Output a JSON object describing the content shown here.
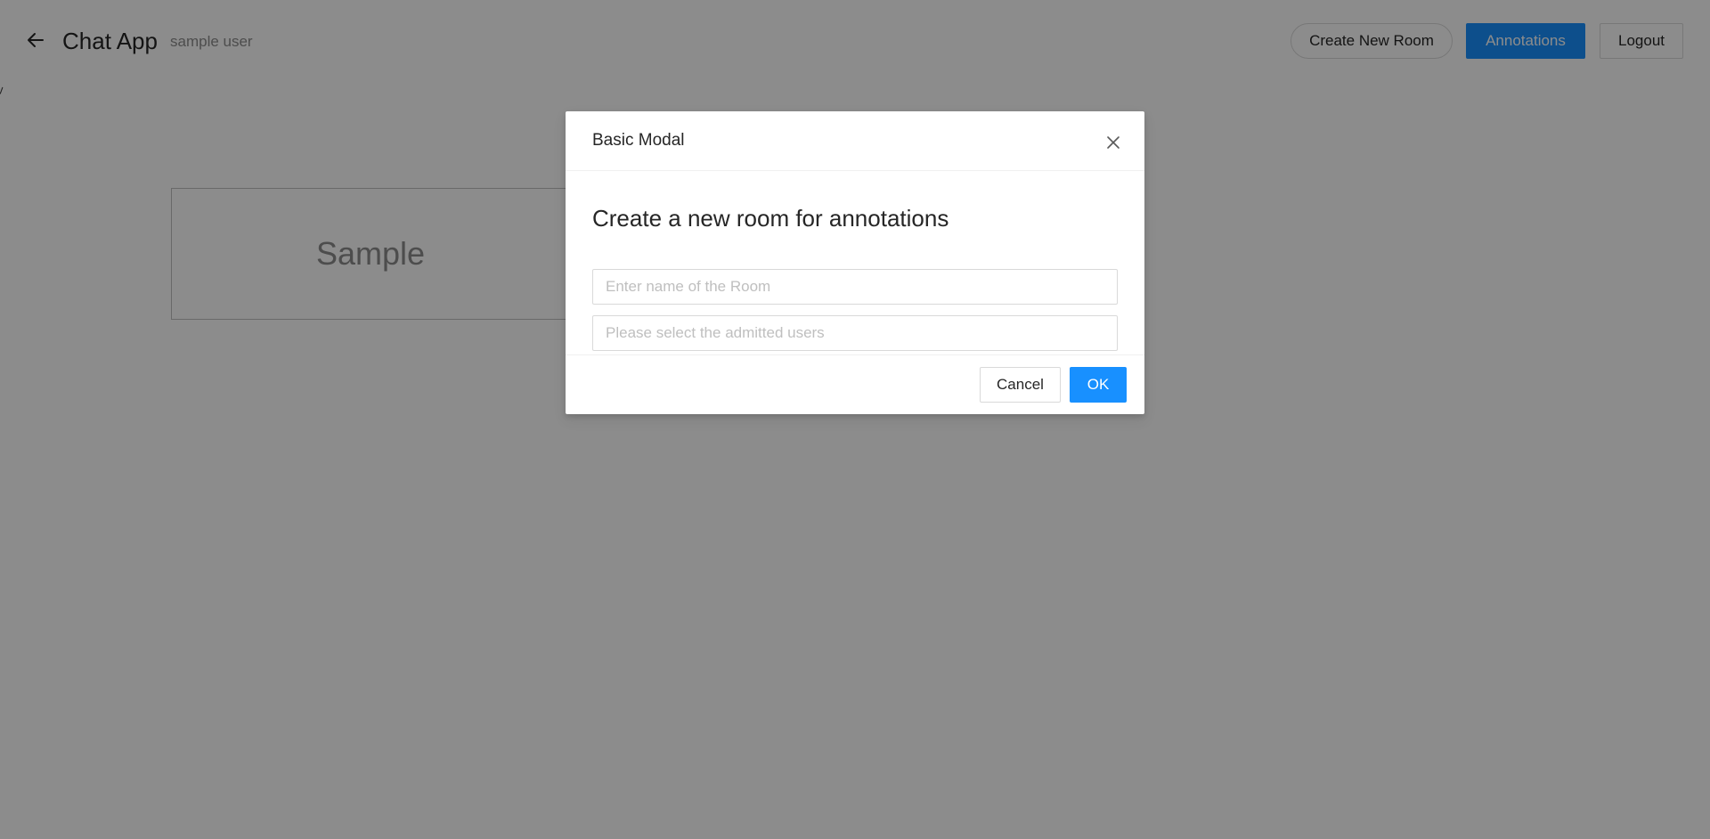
{
  "header": {
    "back_icon": "arrow-left-icon",
    "app_title": "Chat App",
    "user_name": "sample user",
    "create_room_label": "Create New Room",
    "annotations_label": "Annotations",
    "logout_label": "Logout"
  },
  "rooms": [
    {
      "title": "Sample"
    }
  ],
  "modal": {
    "title": "Basic Modal",
    "close_icon": "close-icon",
    "heading": "Create a new room for annotations",
    "room_name_placeholder": "Enter name of the Room",
    "room_name_value": "",
    "users_placeholder": "Please select the admitted users",
    "cancel_label": "Cancel",
    "ok_label": "OK"
  },
  "colors": {
    "primary": "#1890ff",
    "overlay": "rgba(0,0,0,0.45)",
    "text": "#262626",
    "muted": "#8c8c8c",
    "border": "#d9d9d9"
  }
}
